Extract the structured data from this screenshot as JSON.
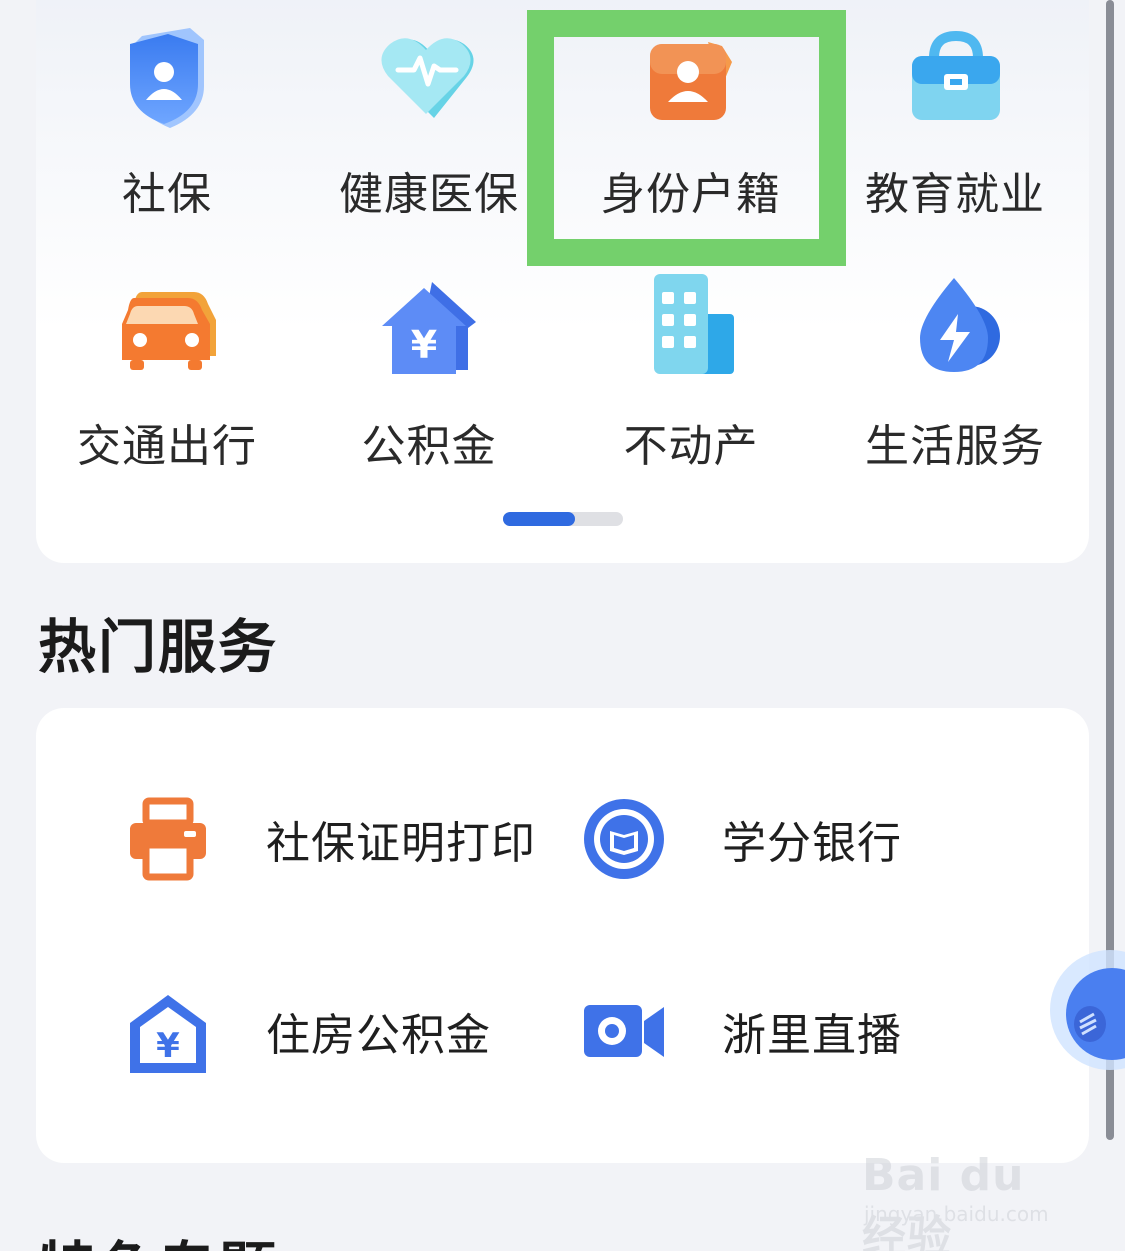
{
  "grid": {
    "items": [
      {
        "label": "社保",
        "icon": "shield-person-icon"
      },
      {
        "label": "健康医保",
        "icon": "heart-pulse-icon"
      },
      {
        "label": "身份户籍",
        "icon": "id-person-icon"
      },
      {
        "label": "教育就业",
        "icon": "briefcase-icon"
      },
      {
        "label": "交通出行",
        "icon": "car-icon"
      },
      {
        "label": "公积金",
        "icon": "house-yuan-icon"
      },
      {
        "label": "不动产",
        "icon": "building-icon"
      },
      {
        "label": "生活服务",
        "icon": "lightning-drop-icon"
      }
    ],
    "pager": {
      "pages": 2,
      "active": 1
    }
  },
  "hot": {
    "title": "热门服务",
    "items": [
      {
        "label": "社保证明打印",
        "icon": "printer-icon"
      },
      {
        "label": "学分银行",
        "icon": "book-circle-icon"
      },
      {
        "label": "住房公积金",
        "icon": "house-yuan-outline-icon"
      },
      {
        "label": "浙里直播",
        "icon": "video-camera-icon"
      }
    ]
  },
  "next_section": {
    "title": "特色专题"
  },
  "watermark": {
    "main": "Bai du 经验",
    "sub": "jingyan.baidu.com"
  },
  "colors": {
    "highlight": "#74d06c",
    "accent": "#2f6ae0",
    "orange": "#f07a32"
  }
}
